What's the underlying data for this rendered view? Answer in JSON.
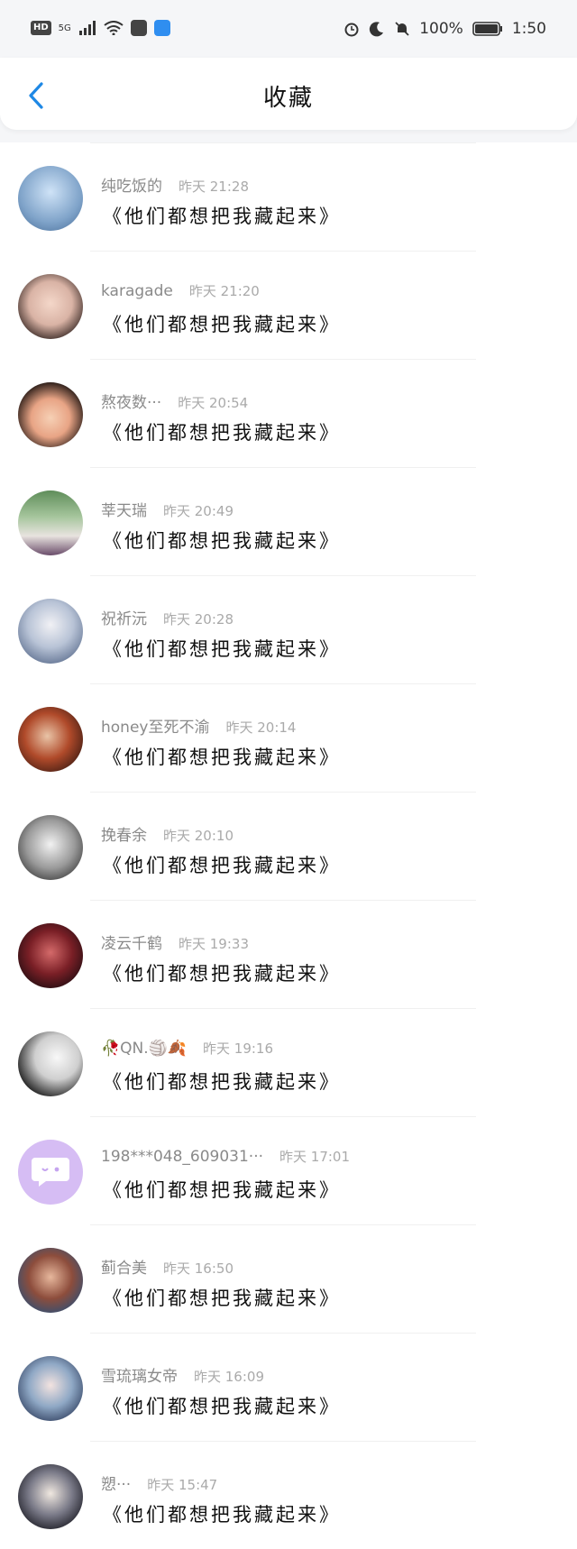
{
  "status_bar": {
    "hd": "HD",
    "network": "5G",
    "battery_pct": "100%",
    "time": "1:50"
  },
  "header": {
    "back_icon": "chevron-left-icon",
    "title": "收藏"
  },
  "accent_color": "#1e88e5",
  "items": [
    {
      "name": "纯吃饭的",
      "time": "昨天 21:28",
      "title": "《他们都想把我藏起来》"
    },
    {
      "name": "karagade",
      "time": "昨天 21:20",
      "title": "《他们都想把我藏起来》"
    },
    {
      "name": "熬夜数···",
      "time": "昨天 20:54",
      "title": "《他们都想把我藏起来》"
    },
    {
      "name": "莘天瑞",
      "time": "昨天 20:49",
      "title": "《他们都想把我藏起来》"
    },
    {
      "name": "祝祈沅",
      "time": "昨天 20:28",
      "title": "《他们都想把我藏起来》"
    },
    {
      "name": "honey至死不渝",
      "time": "昨天 20:14",
      "title": "《他们都想把我藏起来》"
    },
    {
      "name": "挽春余",
      "time": "昨天 20:10",
      "title": "《他们都想把我藏起来》"
    },
    {
      "name": "凌云千鹤",
      "time": "昨天 19:33",
      "title": "《他们都想把我藏起来》"
    },
    {
      "name": "🥀QN.🏐🍂",
      "time": "昨天 19:16",
      "title": "《他们都想把我藏起来》"
    },
    {
      "name": "198***048_609031···",
      "time": "昨天 17:01",
      "title": "《他们都想把我藏起来》"
    },
    {
      "name": "蓟合美",
      "time": "昨天 16:50",
      "title": "《他们都想把我藏起来》"
    },
    {
      "name": "雪琉璃女帝",
      "time": "昨天 16:09",
      "title": "《他们都想把我藏起来》"
    },
    {
      "name": "愬···",
      "time": "昨天 15:47",
      "title": "《他们都想把我藏起来》"
    }
  ]
}
